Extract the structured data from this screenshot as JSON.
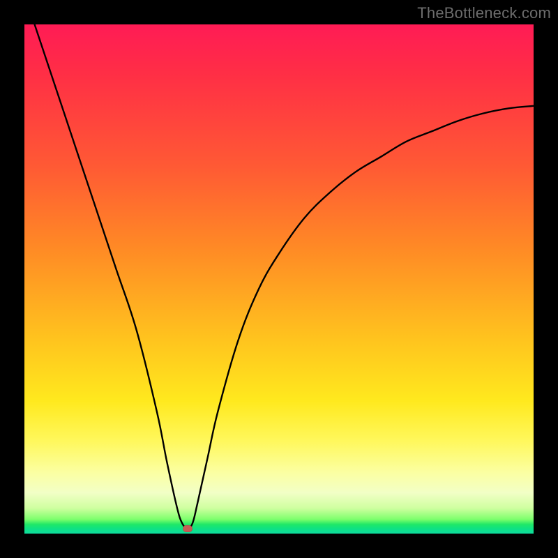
{
  "watermark": "TheBottleneck.com",
  "chart_data": {
    "type": "line",
    "title": "",
    "xlabel": "",
    "ylabel": "",
    "xlim": [
      0,
      100
    ],
    "ylim": [
      0,
      100
    ],
    "grid": false,
    "legend": false,
    "series": [
      {
        "name": "bottleneck-curve",
        "x": [
          2,
          6,
          10,
          14,
          18,
          22,
          26,
          28,
          30,
          31,
          32,
          33,
          34,
          36,
          38,
          42,
          46,
          50,
          55,
          60,
          65,
          70,
          75,
          80,
          85,
          90,
          95,
          100
        ],
        "y": [
          100,
          88,
          76,
          64,
          52,
          40,
          24,
          14,
          5,
          2,
          1,
          2,
          6,
          15,
          24,
          38,
          48,
          55,
          62,
          67,
          71,
          74,
          77,
          79,
          81,
          82.5,
          83.5,
          84
        ]
      }
    ],
    "marker": {
      "x": 32,
      "y": 1,
      "label": "optimal-point"
    },
    "background_gradient": {
      "top": "#ff1b55",
      "mid": "#ffe91e",
      "bottom": "#0edc9e"
    }
  }
}
